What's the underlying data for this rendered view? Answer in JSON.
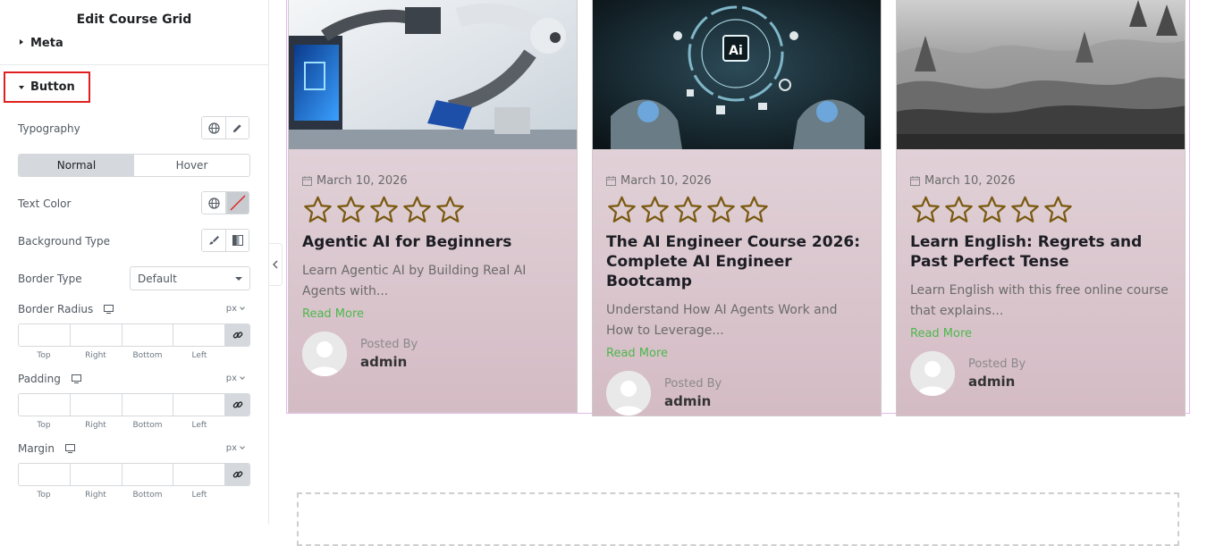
{
  "panel": {
    "title": "Edit Course Grid",
    "section_meta": "Meta",
    "section_button": "Button",
    "typography_label": "Typography",
    "tabs": [
      {
        "label": "Normal",
        "active": true
      },
      {
        "label": "Hover",
        "active": false
      }
    ],
    "text_color_label": "Text Color",
    "background_type_label": "Background Type",
    "border_type_label": "Border Type",
    "border_type_value": "Default",
    "border_radius_label": "Border Radius",
    "padding_label": "Padding",
    "margin_label": "Margin",
    "unit": "px",
    "dim_labels": [
      "Top",
      "Right",
      "Bottom",
      "Left"
    ]
  },
  "cards": [
    {
      "date": "March 10, 2026",
      "title": "Agentic AI for Beginners",
      "excerpt": "Learn Agentic AI by Building Real AI Agents with...",
      "read_more": "Read More",
      "posted_by": "Posted By",
      "author": "admin",
      "rating": 0
    },
    {
      "date": "March 10, 2026",
      "title": "The AI Engineer Course 2026: Complete AI Engineer Bootcamp",
      "excerpt": "Understand How AI Agents Work and How to Leverage...",
      "read_more": "Read More",
      "posted_by": "Posted By",
      "author": "admin",
      "rating": 0
    },
    {
      "date": "March 10, 2026",
      "title": "Learn English: Regrets and Past Perfect Tense",
      "excerpt": "Learn English with this free online course that explains...",
      "read_more": "Read More",
      "posted_by": "Posted By",
      "author": "admin",
      "rating": 0
    }
  ],
  "image_text": {
    "ai_chip": "Ai"
  },
  "colors": {
    "accent_border": "#e02020",
    "read_more": "#4cb84c",
    "star": "#7a5a12",
    "frame": "#e5b8ea"
  },
  "icons": {
    "globe": "globe-icon",
    "pencil": "pencil-icon",
    "brush": "brush-icon",
    "gradient": "gradient-icon",
    "link": "link-icon",
    "monitor": "monitor-icon",
    "calendar": "calendar-icon",
    "star": "star-icon"
  }
}
